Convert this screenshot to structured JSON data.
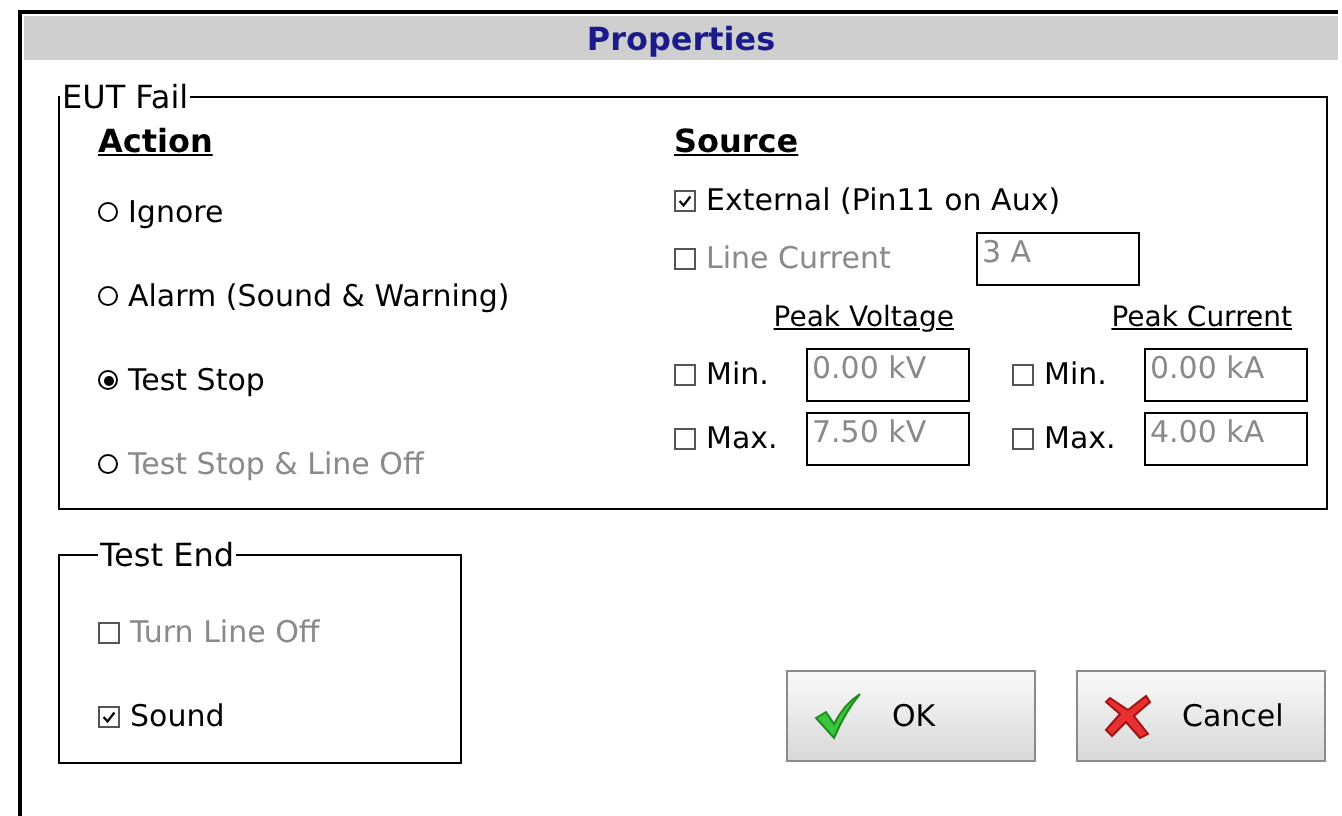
{
  "window": {
    "title": "Properties"
  },
  "eut_fail": {
    "title": "EUT Fail",
    "action": {
      "heading": "Action",
      "options": [
        {
          "label": "Ignore",
          "selected": false,
          "disabled": false
        },
        {
          "label": "Alarm (Sound & Warning)",
          "selected": false,
          "disabled": false
        },
        {
          "label": "Test Stop",
          "selected": true,
          "disabled": false
        },
        {
          "label": "Test Stop & Line Off",
          "selected": false,
          "disabled": true
        }
      ]
    },
    "source": {
      "heading": "Source",
      "external": {
        "label": "External (Pin11 on Aux)",
        "checked": true,
        "disabled": false
      },
      "line_current": {
        "label": "Line Current",
        "checked": false,
        "disabled": true,
        "value": "3 A"
      },
      "peaks": [
        {
          "heading": "Peak Voltage",
          "rows": [
            {
              "label": "Min.",
              "checked": false,
              "value": "0.00 kV"
            },
            {
              "label": "Max.",
              "checked": false,
              "value": "7.50 kV"
            }
          ]
        },
        {
          "heading": "Peak Current",
          "rows": [
            {
              "label": "Min.",
              "checked": false,
              "value": "0.00 kA"
            },
            {
              "label": "Max.",
              "checked": false,
              "value": "4.00 kA"
            }
          ]
        }
      ]
    }
  },
  "test_end": {
    "title": "Test End",
    "options": [
      {
        "label": "Turn Line Off",
        "checked": false,
        "disabled": true
      },
      {
        "label": "Sound",
        "checked": true,
        "disabled": false
      }
    ]
  },
  "buttons": [
    {
      "label": "OK",
      "kind": "ok"
    },
    {
      "label": "Cancel",
      "kind": "cancel"
    }
  ]
}
